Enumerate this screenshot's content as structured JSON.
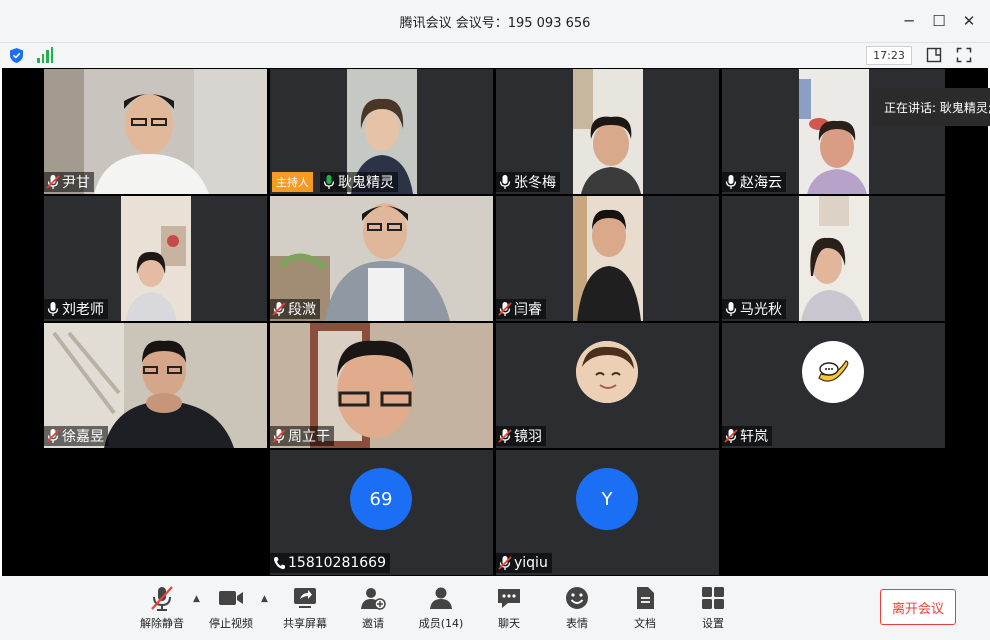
{
  "window": {
    "title": "腾讯会议 会议号：195 093 656",
    "minimize": "─",
    "maximize": "☐",
    "close": "✕"
  },
  "toolbar_top": {
    "time": "17:23"
  },
  "speaking_banner": "正在讲话: 耿鬼精灵;",
  "host_badge": "主持人",
  "participants": [
    {
      "name": "尹甘",
      "muted": true,
      "type": "video"
    },
    {
      "name": "耿鬼精灵",
      "muted": false,
      "type": "video",
      "host": true
    },
    {
      "name": "张冬梅",
      "muted": false,
      "type": "video"
    },
    {
      "name": "赵海云",
      "muted": false,
      "type": "video"
    },
    {
      "name": "刘老师",
      "muted": false,
      "type": "video"
    },
    {
      "name": "段溦",
      "muted": true,
      "type": "video"
    },
    {
      "name": "闫睿",
      "muted": true,
      "type": "video"
    },
    {
      "name": "马光秋",
      "muted": false,
      "type": "video"
    },
    {
      "name": "徐嘉昱",
      "muted": true,
      "type": "video"
    },
    {
      "name": "周立干",
      "muted": true,
      "type": "video"
    },
    {
      "name": "镜羽",
      "muted": true,
      "type": "avatar"
    },
    {
      "name": "轩岚",
      "muted": true,
      "type": "avatar"
    },
    {
      "name": "15810281669",
      "muted": false,
      "type": "phone",
      "initial": "69"
    },
    {
      "name": "yiqiu",
      "muted": true,
      "type": "initial",
      "initial": "Y"
    }
  ],
  "bottom_toolbar": {
    "unmute": "解除静音",
    "stop_video": "停止视频",
    "share_screen": "共享屏幕",
    "invite": "邀请",
    "members": "成员(14)",
    "chat": "聊天",
    "reactions": "表情",
    "docs": "文档",
    "settings": "设置",
    "leave": "离开会议"
  },
  "colors": {
    "accent_blue": "#1a6ff5",
    "leave_red": "#e8403a",
    "host_orange": "#f59a23",
    "tile_bg": "#2c2d30",
    "signal_green": "#21b24b"
  }
}
